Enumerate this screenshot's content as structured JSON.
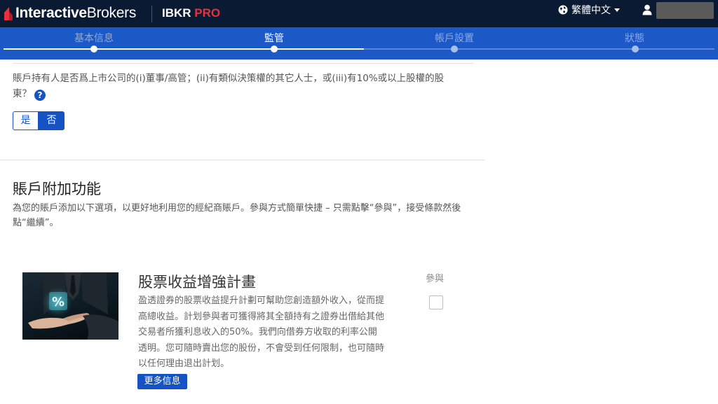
{
  "header": {
    "logo_text_bold": "Interactive",
    "logo_text_rest": "Brokers",
    "product_name": "IBKR",
    "product_suffix": "PRO",
    "language": "繁體中文"
  },
  "stepper": {
    "steps": [
      {
        "label": "基本信息",
        "state": "done"
      },
      {
        "label": "監管",
        "state": "active"
      },
      {
        "label": "帳戶設置",
        "state": "todo"
      },
      {
        "label": "狀態",
        "state": "todo"
      }
    ]
  },
  "question": {
    "text": "賬戶持有人是否爲上市公司的(i)董事/高管；(ii)有類似決策權的其它人士，或(iii)有10%或以上股權的股東？",
    "help_glyph": "?",
    "yes_label": "是",
    "no_label": "否",
    "selected": "否"
  },
  "features": {
    "title": "賬戶附加功能",
    "description": "為您的賬戶添加以下選項，以更好地利用您的經紀商賬戶。參與方式簡單快捷 – 只需點擊“參與”，接受條款然後點“繼續”。"
  },
  "card": {
    "title": "股票收益增強計畫",
    "description": "盈透證券的股票收益提升計劃可幫助您創造額外收入，從而提高總收益。計划參與者可獲得將其全額持有之證券出借給其他交易者所獲利息收入的50%。我們向借券方收取的利率公開透明。您可隨時賣出您的股份，不會受到任何限制，也可隨時以任何理由退出計划。",
    "more_label": "更多信息",
    "join_label": "參與",
    "join_checked": false,
    "image_glyph": "%"
  },
  "colors": {
    "topbar": "#0b1a33",
    "stepper": "#1d58c7",
    "accent": "#1552c4",
    "brand_red": "#e6323c"
  }
}
